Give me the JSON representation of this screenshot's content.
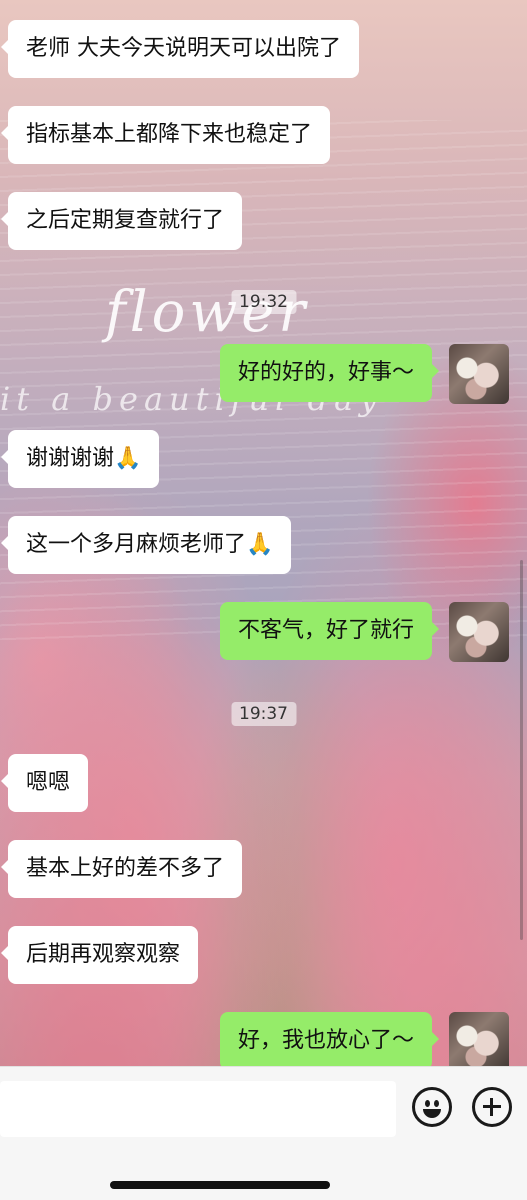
{
  "background_watermark": {
    "title": "flower",
    "tagline": "it a beautiful day"
  },
  "messages": [
    {
      "side": "in",
      "text": "老师 大夫今天说明天可以出院了"
    },
    {
      "side": "in",
      "text": "指标基本上都降下来也稳定了"
    },
    {
      "side": "in",
      "text": "之后定期复查就行了"
    },
    {
      "type": "time",
      "text": "19:32"
    },
    {
      "side": "out",
      "text": "好的好的，好事～"
    },
    {
      "side": "in",
      "text": "谢谢谢谢🙏"
    },
    {
      "side": "in",
      "text": "这一个多月麻烦老师了🙏"
    },
    {
      "side": "out",
      "text": "不客气，好了就行"
    },
    {
      "type": "time",
      "text": "19:37"
    },
    {
      "side": "in",
      "text": "嗯嗯"
    },
    {
      "side": "in",
      "text": "基本上好的差不多了"
    },
    {
      "side": "in",
      "text": "后期再观察观察"
    },
    {
      "side": "out",
      "text": "好，我也放心了～"
    }
  ],
  "input_bar": {
    "text_value": "",
    "emoji_icon": "smiley-face-icon",
    "plus_icon": "plus-circle-icon"
  },
  "colors": {
    "outgoing_bubble": "#95ec69",
    "incoming_bubble": "#ffffff"
  }
}
